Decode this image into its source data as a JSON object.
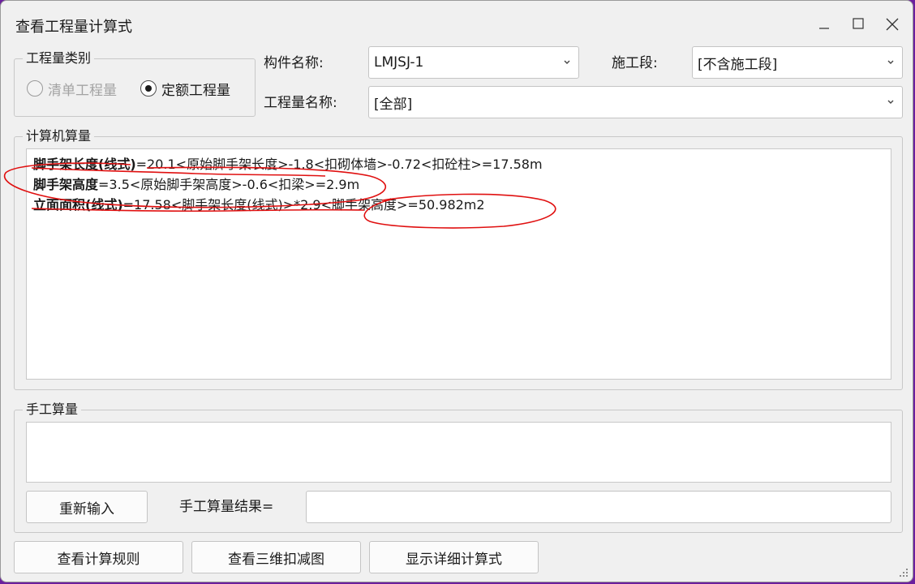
{
  "window": {
    "title": "查看工程量计算式"
  },
  "qty_type": {
    "legend": "工程量类别",
    "options": [
      {
        "label": "清单工程量",
        "checked": false,
        "disabled": true
      },
      {
        "label": "定额工程量",
        "checked": true,
        "disabled": false
      }
    ]
  },
  "component": {
    "label": "构件名称:",
    "value": "LMJSJ-1"
  },
  "stage": {
    "label": "施工段:",
    "value": "[不含施工段]"
  },
  "qty_name": {
    "label": "工程量名称:",
    "value": "[全部]"
  },
  "computer": {
    "legend": "计算机算量",
    "lines": [
      {
        "name": "脚手架长度(线式)",
        "expr": "=20.1<原始脚手架长度>-1.8<扣砌体墙>-0.72<扣砼柱>=17.58m"
      },
      {
        "name": "脚手架高度",
        "expr": "=3.5<原始脚手架高度>-0.6<扣梁>=2.9m"
      },
      {
        "name": "立面面积(线式)",
        "expr": "=17.58<脚手架长度(线式)>*2.9<脚手架高度>=50.982m2"
      }
    ]
  },
  "manual": {
    "legend": "手工算量",
    "reenter_label": "重新输入",
    "result_label": "手工算量结果=",
    "result_value": ""
  },
  "footer": {
    "rules_label": "查看计算规则",
    "view3d_label": "查看三维扣减图",
    "detail_label": "显示详细计算式"
  },
  "colors": {
    "annotation": "#e01010",
    "window_bg": "#f0f0f0",
    "outer_bg": "#6b1f9e"
  },
  "icons": {
    "minimize": "minimize-icon",
    "maximize": "maximize-icon",
    "close": "close-icon",
    "dropdown": "chevron-down-icon",
    "grip": "resize-grip-icon"
  }
}
